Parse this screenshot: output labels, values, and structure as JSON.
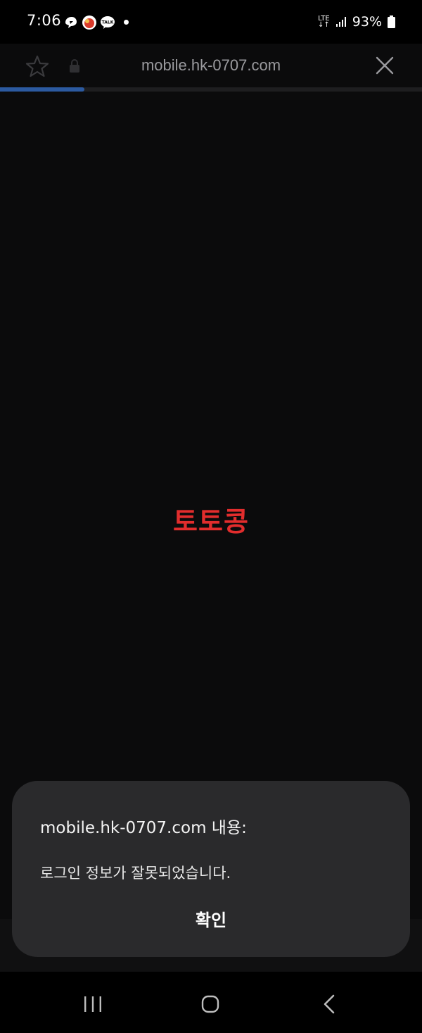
{
  "status_bar": {
    "time": "7:06",
    "notification_icons": [
      "chat-bubble-icon",
      "app-avatar-icon",
      "kakaotalk-icon"
    ],
    "talk_icon_label": "TALK",
    "network_type": "LTE",
    "battery_percent": "93%"
  },
  "browser": {
    "url": "mobile.hk-0707.com",
    "progress": 0.2,
    "progress_color": "#2c5aa0"
  },
  "page": {
    "brand_text": "토토콩",
    "brand_color": "#e22d2d"
  },
  "dialog": {
    "title": "mobile.hk-0707.com 내용:",
    "message": "로그인 정보가 잘못되었습니다.",
    "ok_label": "확인"
  },
  "nav_bar": {
    "icons": [
      "recent-apps-icon",
      "home-icon",
      "back-icon"
    ]
  }
}
